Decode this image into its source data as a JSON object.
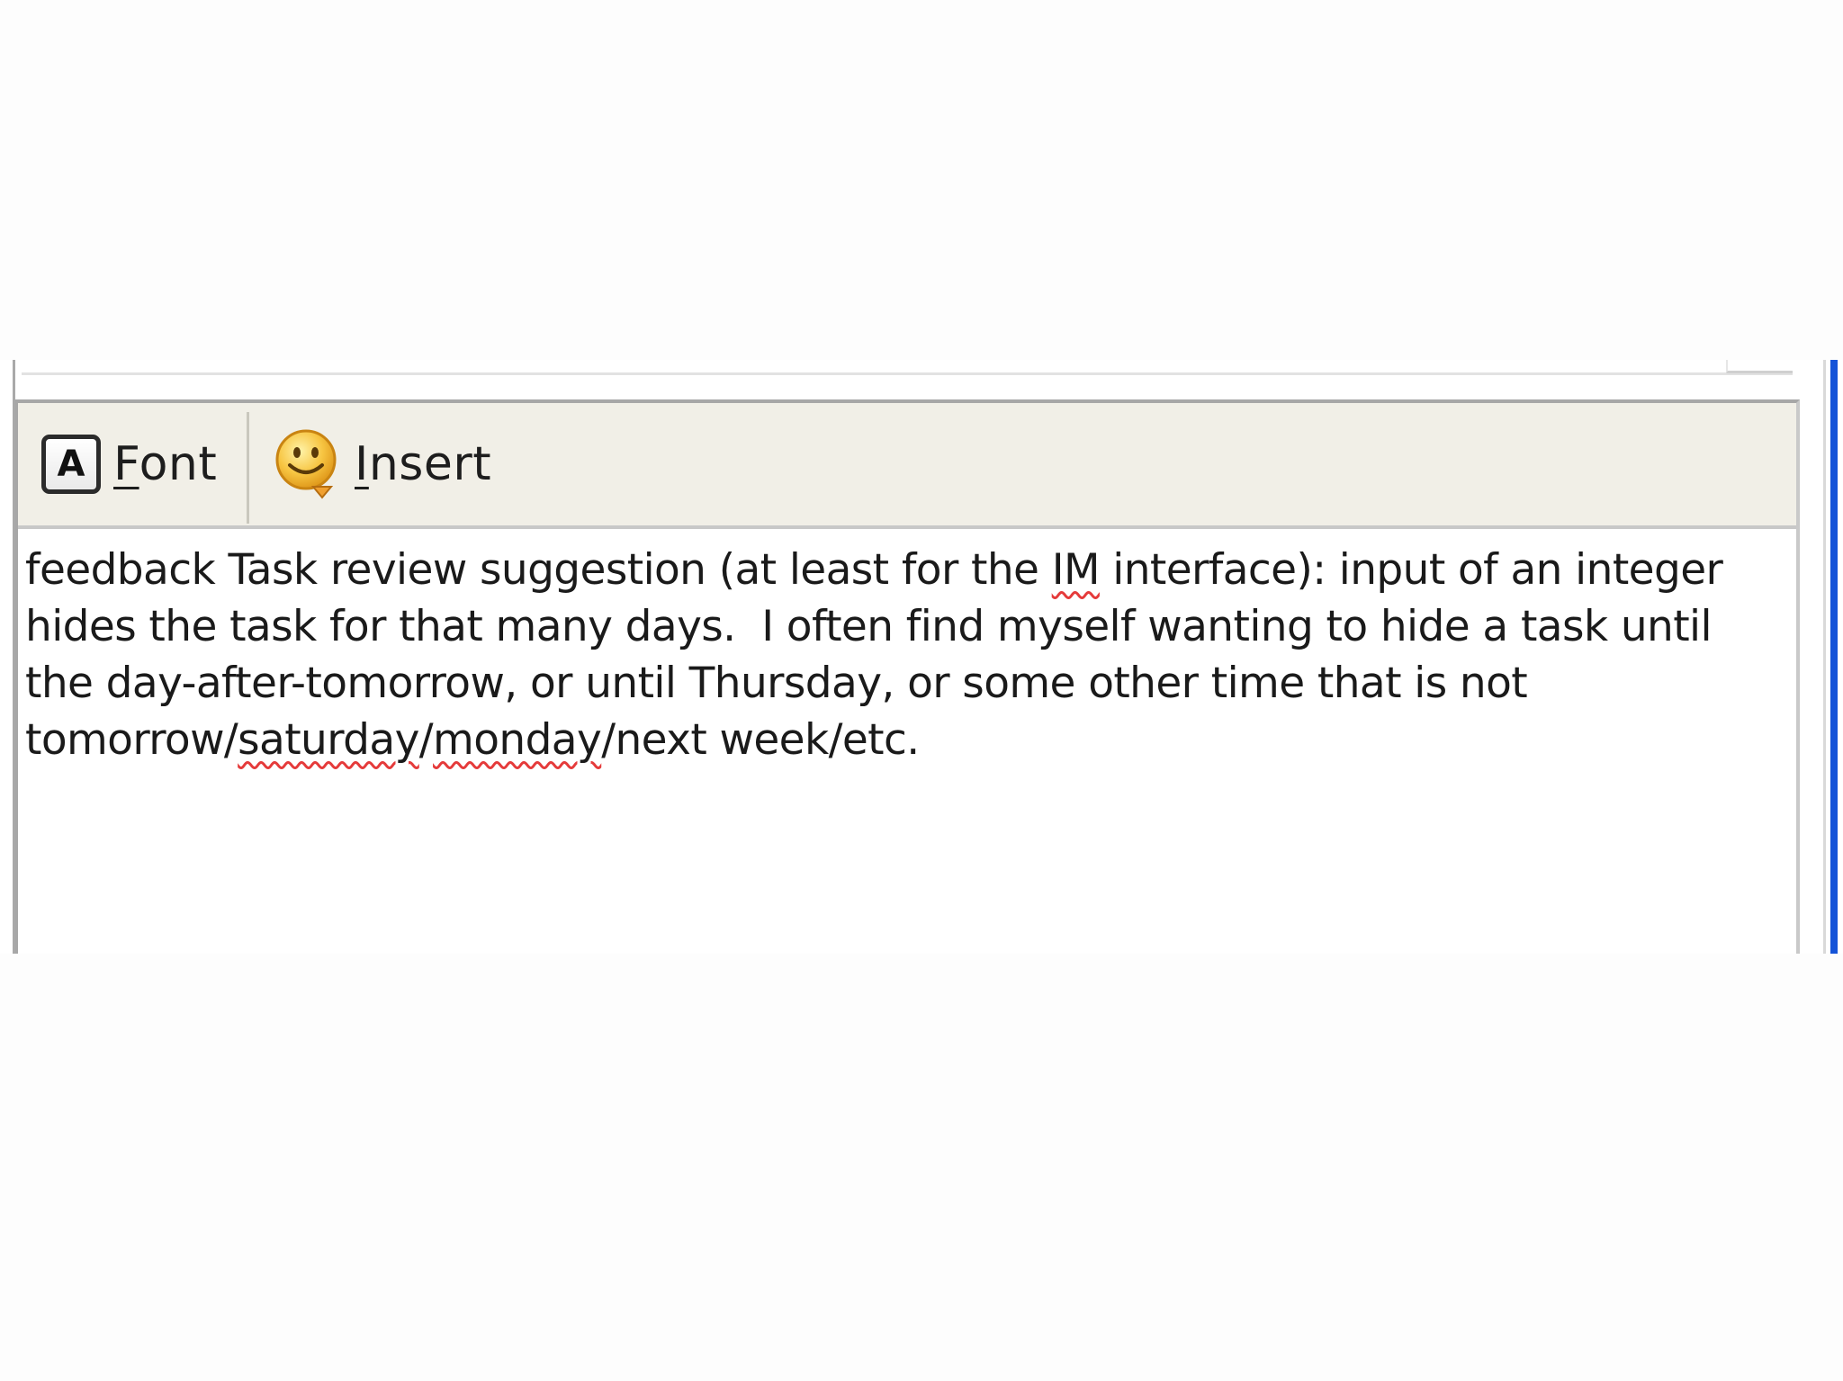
{
  "toolbar": {
    "font_label_mnemonic": "F",
    "font_label_rest": "ont",
    "font_icon_glyph": "A",
    "insert_label_mnemonic": "I",
    "insert_label_rest": "nsert",
    "icons": {
      "font": "font-icon",
      "insert": "smiley-icon"
    }
  },
  "editor": {
    "segments": [
      "feedback Task review suggestion (at least for the ",
      "IM",
      " interface): input of an integer hides the task for that many days.  I often find myself wanting to hide a task until the day-after-tomorrow, or until Thursday, or some other time that is not tomorrow/",
      "saturday",
      "/",
      "monday",
      "/next week/etc."
    ]
  },
  "colors": {
    "toolbar_bg": "#f1efe7",
    "spellcheck_underline": "#e53b3b",
    "scrollbar_accent": "#1453d8"
  }
}
